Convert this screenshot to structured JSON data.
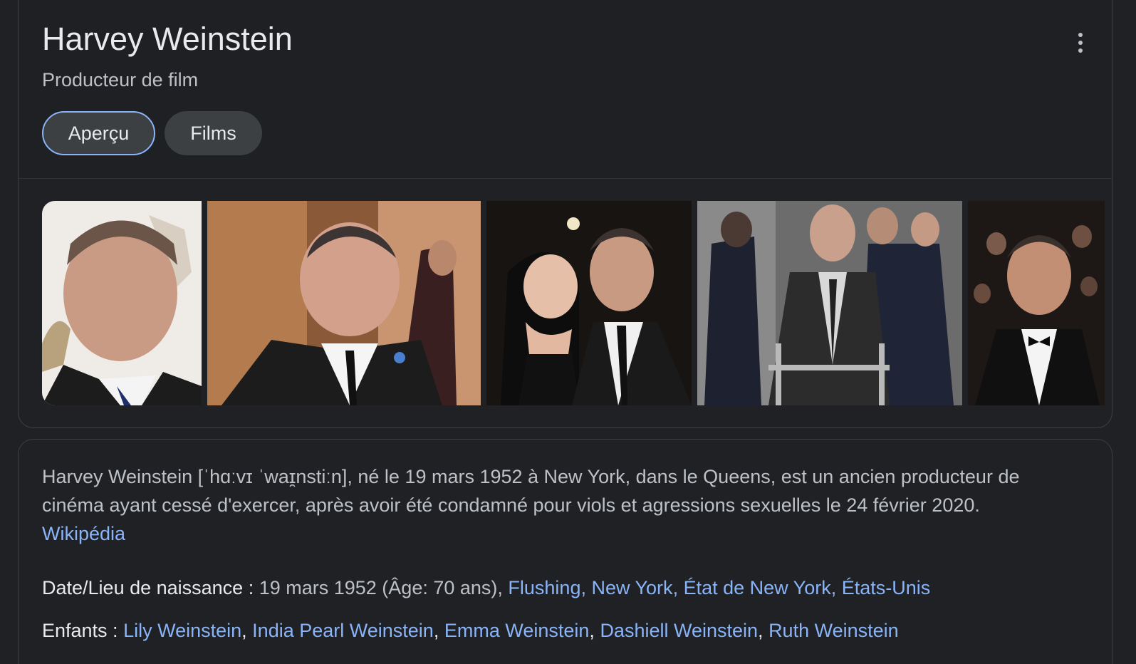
{
  "panel": {
    "title": "Harvey Weinstein",
    "subtitle": "Producteur de film",
    "more_icon": "more-vert-icon",
    "tabs": [
      {
        "label": "Aperçu",
        "selected": true
      },
      {
        "label": "Films",
        "selected": false
      }
    ]
  },
  "description": {
    "text": "Harvey Weinstein [ˈhɑːvɪ ˈwaɪ̯nstiːn], né le 19 mars 1952 à New York, dans le Queens, est un ancien producteur de cinéma ayant cessé d'exercer, après avoir été condamné pour viols et agressions sexuelles le 24 février 2020.",
    "source_link": "Wikipédia"
  },
  "facts": {
    "birth": {
      "label": "Date/Lieu de naissance : ",
      "value": "19 mars 1952 (Âge: 70 ans), ",
      "links": [
        "Flushing",
        "New York",
        "État de New York",
        "États-Unis"
      ]
    },
    "children": {
      "label": "Enfants : ",
      "links": [
        "Lily Weinstein",
        "India Pearl Weinstein",
        "Emma Weinstein",
        "Dashiell Weinstein",
        "Ruth Weinstein"
      ]
    }
  },
  "colors": {
    "background": "#202124",
    "link": "#8ab4f8",
    "text": "#e8eaed",
    "muted": "#bdc1c6"
  }
}
